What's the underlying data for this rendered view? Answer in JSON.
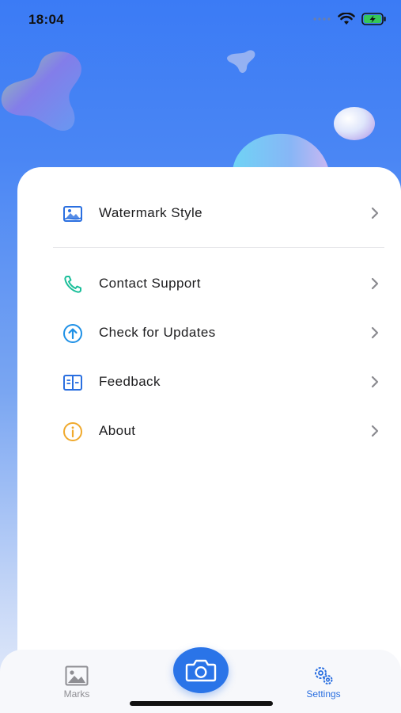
{
  "status_bar": {
    "time": "18:04"
  },
  "menu": {
    "items": [
      {
        "label": "Watermark Style",
        "icon": "image-frame-icon",
        "color": "#2a6fe0"
      },
      {
        "label": "Contact Support",
        "icon": "phone-icon",
        "color": "#1bbf9a"
      },
      {
        "label": "Check for Updates",
        "icon": "arrow-up-circle-icon",
        "color": "#1e90e6"
      },
      {
        "label": "Feedback",
        "icon": "book-icon",
        "color": "#2a6fe0"
      },
      {
        "label": "About",
        "icon": "info-circle-icon",
        "color": "#f0a92c"
      }
    ]
  },
  "tab_bar": {
    "tabs": [
      {
        "label": "Marks",
        "icon": "photo-icon",
        "active": false
      },
      {
        "label": "Settings",
        "icon": "gears-icon",
        "active": true
      }
    ],
    "center_action_icon": "camera-icon"
  },
  "colors": {
    "accent": "#2a74e8",
    "active_tab": "#2a6fe0",
    "inactive_tab": "#8e8e93"
  }
}
